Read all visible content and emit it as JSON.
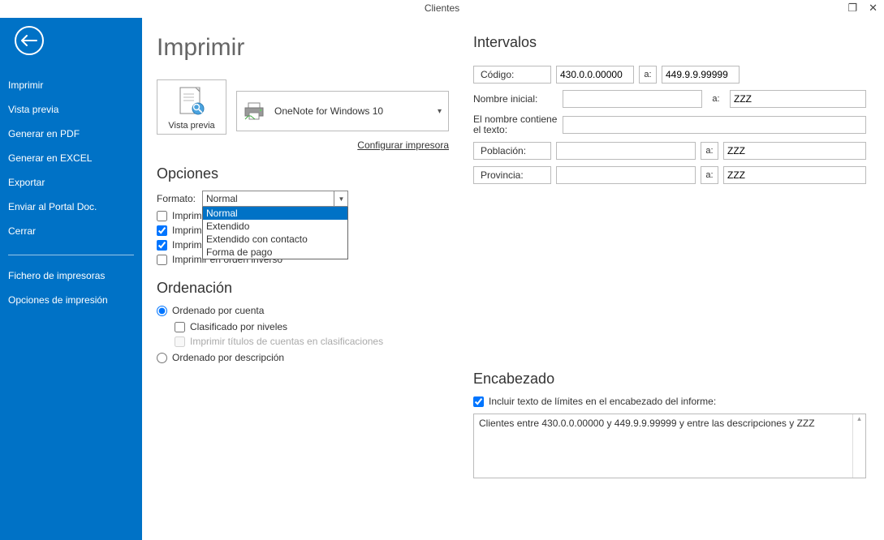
{
  "titlebar": {
    "title": "Clientes"
  },
  "sidebar": {
    "items": [
      "Imprimir",
      "Vista previa",
      "Generar en PDF",
      "Generar en EXCEL",
      "Exportar",
      "Enviar al Portal Doc.",
      "Cerrar"
    ],
    "footer_items": [
      "Fichero de impresoras",
      "Opciones de impresión"
    ]
  },
  "page": {
    "title": "Imprimir",
    "preview_label": "Vista previa",
    "printer_name": "OneNote for Windows 10",
    "configure_label": "Configurar impresora"
  },
  "opciones": {
    "heading": "Opciones",
    "format_label": "Formato:",
    "format_selected": "Normal",
    "format_options": [
      "Normal",
      "Extendido",
      "Extendido con contacto",
      "Forma de pago"
    ],
    "chk_imprimir1": "Imprim",
    "chk_imprimir2": "Imprim",
    "chk_sin_mov": "Imprimir cuentas sin movimientos",
    "chk_inverso": "Imprimir en orden inverso"
  },
  "ordenacion": {
    "heading": "Ordenación",
    "radio_cuenta": "Ordenado por cuenta",
    "chk_clasificado": "Clasificado por niveles",
    "chk_titulos": "Imprimir títulos de cuentas en clasificaciones",
    "radio_descripcion": "Ordenado por descripción"
  },
  "intervalos": {
    "heading": "Intervalos",
    "codigo_label": "Código:",
    "codigo_from": "430.0.0.00000",
    "codigo_to": "449.9.9.99999",
    "nombre_label": "Nombre inicial:",
    "nombre_from": "",
    "nombre_to": "ZZZ",
    "contiene_label": "El nombre contiene el texto:",
    "contiene_value": "",
    "poblacion_label": "Población:",
    "poblacion_from": "",
    "poblacion_to": "ZZZ",
    "provincia_label": "Provincia:",
    "provincia_from": "",
    "provincia_to": "ZZZ",
    "a_label": "a:"
  },
  "encabezado": {
    "heading": "Encabezado",
    "chk_label": "Incluir texto de límites en el encabezado del informe:",
    "text": "Clientes entre 430.0.0.00000 y 449.9.9.99999 y entre las descripciones  y ZZZ"
  }
}
